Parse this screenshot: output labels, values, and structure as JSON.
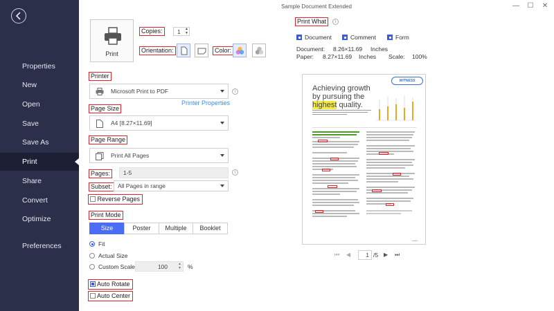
{
  "window": {
    "title": "Sample Document Extended"
  },
  "sidebar": {
    "items": [
      {
        "label": "Properties"
      },
      {
        "label": "New"
      },
      {
        "label": "Open"
      },
      {
        "label": "Save"
      },
      {
        "label": "Save As"
      },
      {
        "label": "Print"
      },
      {
        "label": "Share"
      },
      {
        "label": "Convert"
      },
      {
        "label": "Optimize"
      },
      {
        "label": "Preferences"
      }
    ]
  },
  "print_button": {
    "label": "Print"
  },
  "copies": {
    "label": "Copies:",
    "value": "1"
  },
  "orientation": {
    "label": "Orientation:"
  },
  "color": {
    "label": "Color:"
  },
  "printer": {
    "label": "Printer",
    "value": "Microsoft Print to PDF",
    "properties_link": "Printer Properties"
  },
  "page_size": {
    "label": "Page Size",
    "value": "A4 [8.27×11.69]"
  },
  "page_range": {
    "label": "Page Range",
    "value": "Print All Pages"
  },
  "pages": {
    "label": "Pages:",
    "value": "1-5"
  },
  "subset": {
    "label": "Subset:",
    "value": "All Pages in range"
  },
  "reverse_pages": {
    "label": "Reverse Pages",
    "checked": false
  },
  "print_mode": {
    "label": "Print Mode",
    "tabs": [
      "Size",
      "Poster",
      "Multiple",
      "Booklet"
    ],
    "selected_tab": "Size"
  },
  "size_options": {
    "fit": "Fit",
    "actual": "Actual Size",
    "custom": "Custom Scale:",
    "custom_value": "100",
    "percent": "%"
  },
  "auto_rotate": {
    "label": "Auto Rotate",
    "checked": true
  },
  "auto_center": {
    "label": "Auto Center",
    "checked": false
  },
  "print_what": {
    "label": "Print What",
    "document": "Document",
    "comment": "Comment",
    "form": "Form"
  },
  "doc_info": {
    "document_label": "Document:",
    "document_size": "8.26×11.69",
    "document_unit": "Inches",
    "paper_label": "Paper:",
    "paper_size": "8.27×11.69",
    "paper_unit": "Inches",
    "scale_label": "Scale:",
    "scale_value": "100%"
  },
  "preview": {
    "heading1": "Achieving growth",
    "heading2": "by pursuing the",
    "heading3_highlight": "highest",
    "heading3_rest": " quality.",
    "badge": "WITNESS",
    "page_current": "1",
    "page_total": "/5"
  },
  "colors": {
    "sidebar": "#2b2f4a",
    "accent": "#4a6cf7",
    "highlight_border": "#e0252a"
  }
}
